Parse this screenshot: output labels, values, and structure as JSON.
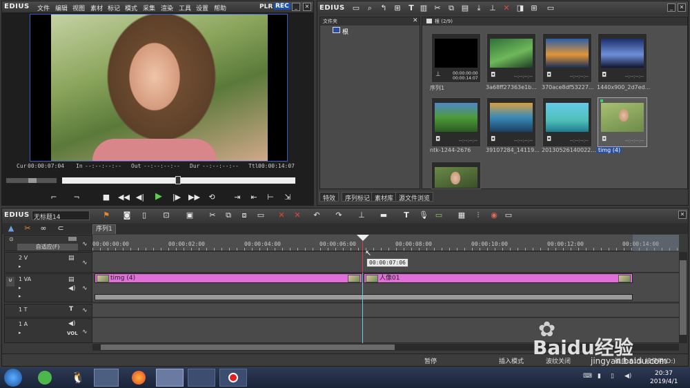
{
  "player": {
    "logo": "EDIUS",
    "menu": [
      "文件",
      "编辑",
      "视图",
      "素材",
      "标记",
      "模式",
      "采集",
      "渲染",
      "工具",
      "设置",
      "帮助"
    ],
    "plr": "PLR",
    "rec": "REC",
    "cur_label": "Cur",
    "cur_value": "00:00:07:04",
    "in_label": "In",
    "in_value": "--:--:--:--",
    "out_label": "Out",
    "out_value": "--:--:--:--",
    "dur_label": "Dur",
    "dur_value": "--:--:--:--",
    "ttl_label": "Ttl",
    "ttl_value": "00:00:14:07"
  },
  "bin": {
    "logo": "EDIUS",
    "folder_header": "文件夹",
    "root_label": "根",
    "bin_header": "根 (2/9)",
    "tabs": [
      "特效",
      "序列标记",
      "素材库",
      "源文件浏览"
    ],
    "items": [
      {
        "name": "序列1",
        "tc1": "00:00:00:00",
        "tc2": "00:00:14:07",
        "kind": "sequence"
      },
      {
        "name": "3a68ff27363e1b...",
        "dash": "--:--:--:--",
        "colors": [
          "#2f6f3a",
          "#6fb85a",
          "#1c3d22"
        ]
      },
      {
        "name": "370ace8df53227...",
        "dash": "--:--:--:--",
        "colors": [
          "#2b5fa8",
          "#e0953a",
          "#1b2f55"
        ]
      },
      {
        "name": "1440x900_2d7ed...",
        "dash": "--:--:--:--",
        "colors": [
          "#1d2f6b",
          "#6e8fd8",
          "#0f1530"
        ]
      },
      {
        "name": "ntk-1244-2676",
        "dash": "--:--:--:--",
        "colors": [
          "#4d86c9",
          "#4f9a3a",
          "#2a5a22"
        ]
      },
      {
        "name": "39107284_14119...",
        "dash": "--:--:--:--",
        "colors": [
          "#d8a040",
          "#3a8ab8",
          "#1b3e60"
        ]
      },
      {
        "name": "20130526140022...",
        "dash": "--:--:--:--",
        "colors": [
          "#68c8e8",
          "#4fc0b8",
          "#1f7a90"
        ]
      },
      {
        "name": "timg (4)",
        "dash": "--:--:--:--",
        "colors": [
          "#a8c070",
          "#e0c0a0",
          "#6c8a4a"
        ],
        "selected": true
      },
      {
        "name": "",
        "colors": [
          "#6b8a48",
          "#e3c2a4",
          "#3a4f2a"
        ]
      }
    ]
  },
  "timeline": {
    "logo": "EDIUS",
    "title": "无标题14",
    "seq_tab": "序列1",
    "ruler": [
      "00:00:00:00",
      "00:00:02:00",
      "00:00:04:00",
      "00:00:06:00",
      "00:00:08:00",
      "00:00:10:00",
      "00:00:12:00",
      "00:00:14:00"
    ],
    "tooltip": "00:00:07:06",
    "adapt_label": "自适应(F)",
    "tracks": {
      "v2": "2 V",
      "va1": "1 VA",
      "t1": "1 T",
      "a1": "1 A",
      "vol": "VOL"
    },
    "clip1": "timg (4)",
    "clip2": "人像01"
  },
  "status": {
    "pause": "暂停",
    "insert_mode": "插入模式",
    "ripple": "波纹关闭",
    "disk": "磁盘:61% 被使用(D:)"
  },
  "taskbar": {
    "time": "20:37",
    "date": "2019/4/1"
  },
  "watermark": {
    "brand": "Baidu经验",
    "url": "jingyan.baidu.com"
  }
}
